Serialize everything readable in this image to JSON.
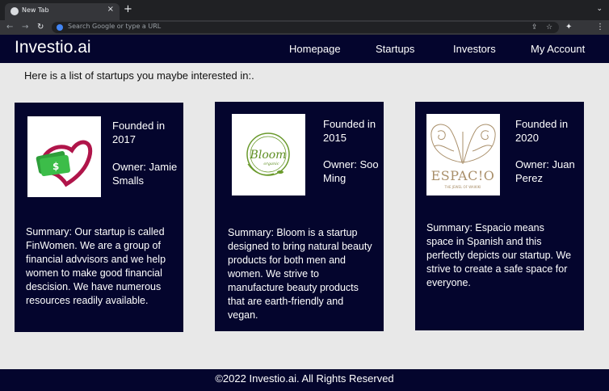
{
  "browser": {
    "tab_title": "New Tab",
    "tab_close": "×",
    "new_tab": "+",
    "omnibox_placeholder": "Search Google or type a URL",
    "back": "←",
    "forward": "→",
    "reload": "↻",
    "share": "⇪",
    "bookmark": "☆",
    "extensions": "✦",
    "menu": "⋮",
    "tab_search": "⌄"
  },
  "site": {
    "brand": "Investio.ai",
    "nav": [
      "Homepage",
      "Startups",
      "Investors",
      "My Account"
    ],
    "intro": "Here is a list of startups you maybe interested in:.",
    "footer": "©2022 Investio.ai. All Rights Reserved"
  },
  "startups": [
    {
      "logo": "finwomen-logo",
      "founded_label": "Founded in 2017",
      "owner_label": "Owner: Jamie Smalls",
      "summary": "Summary: Our startup is called FinWomen. We  are a group of financial advvisors and we help women to make good financial descision. We have numerous resources readily available."
    },
    {
      "logo": "bloom-logo",
      "logo_text": "Bloom",
      "logo_subtext": "organic",
      "founded_label": "Founded in 2015",
      "owner_label": "Owner: Soo Ming",
      "summary": "Summary: Bloom is a startup designed to bring natural beauty products for both men and women. We strive to manufacture beauty products that are earth-friendly and vegan."
    },
    {
      "logo": "espacio-logo",
      "logo_text": "ESPAC!O",
      "logo_subtext": "THE JEWEL OF WAIKIKI",
      "founded_label": "Founded in 2020",
      "owner_label": "Owner: Juan Perez",
      "summary": "Summary: Espacio means space in Spanish and this perfectly depicts our startup. We strive to create a safe space for everyone."
    }
  ]
}
